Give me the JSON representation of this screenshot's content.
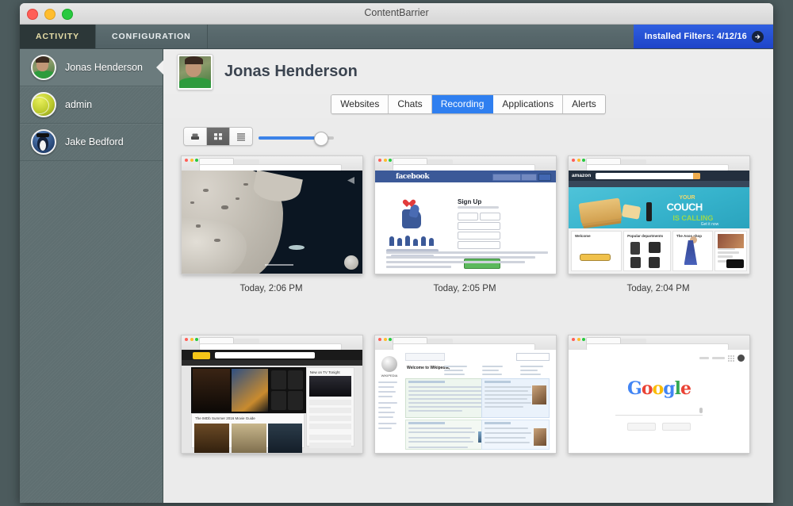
{
  "window": {
    "title": "ContentBarrier",
    "traffic_lights": [
      "close-button",
      "minimize-button",
      "zoom-button"
    ]
  },
  "toolbar": {
    "tabs": [
      {
        "label": "ACTIVITY",
        "active": true
      },
      {
        "label": "CONFIGURATION",
        "active": false
      }
    ],
    "filters_badge": {
      "label": "Installed Filters: 4/12/16",
      "arrow_icon": "arrow-right-circle-icon",
      "color": "#2446cc"
    }
  },
  "sidebar": {
    "users": [
      {
        "name": "Jonas Henderson",
        "avatar": "photo-avatar",
        "selected": true
      },
      {
        "name": "admin",
        "avatar": "tennis-ball-avatar",
        "selected": false
      },
      {
        "name": "Jake Bedford",
        "avatar": "penguin-avatar",
        "selected": false
      }
    ]
  },
  "profile": {
    "name": "Jonas Henderson",
    "avatar": "user-photo"
  },
  "tabs": {
    "items": [
      {
        "label": "Websites",
        "active": false
      },
      {
        "label": "Chats",
        "active": false
      },
      {
        "label": "Recording",
        "active": true
      },
      {
        "label": "Applications",
        "active": false
      },
      {
        "label": "Alerts",
        "active": false
      }
    ],
    "accent": "#2f7ff0"
  },
  "view_controls": {
    "modes": [
      {
        "icon": "coverflow-view-icon",
        "active": false
      },
      {
        "icon": "grid-view-icon",
        "active": true
      },
      {
        "icon": "list-view-icon",
        "active": false
      }
    ],
    "zoom_slider": {
      "value": 82,
      "min": 0,
      "max": 100,
      "fill_color": "#3b82e8"
    }
  },
  "recordings": [
    {
      "caption": "Today, 2:06 PM",
      "site": "map-satellite-screenshot"
    },
    {
      "caption": "Today, 2:05 PM",
      "site": "facebook-signup-screenshot"
    },
    {
      "caption": "Today, 2:04 PM",
      "site": "amazon-home-screenshot"
    },
    {
      "caption": "",
      "site": "imdb-home-screenshot"
    },
    {
      "caption": "",
      "site": "wikipedia-main-page-screenshot"
    },
    {
      "caption": "",
      "site": "google-home-screenshot"
    }
  ],
  "thumbnails": {
    "facebook": {
      "logo": "facebook",
      "heading": "Sign Up"
    },
    "amazon": {
      "line1": "YOUR",
      "line2": "COUCH",
      "line3": "IS CALLING",
      "line4": "Get it now"
    },
    "google": {
      "g1": "G",
      "g2": "o",
      "g3": "o",
      "g4": "g",
      "g5": "l",
      "g6": "e"
    }
  }
}
